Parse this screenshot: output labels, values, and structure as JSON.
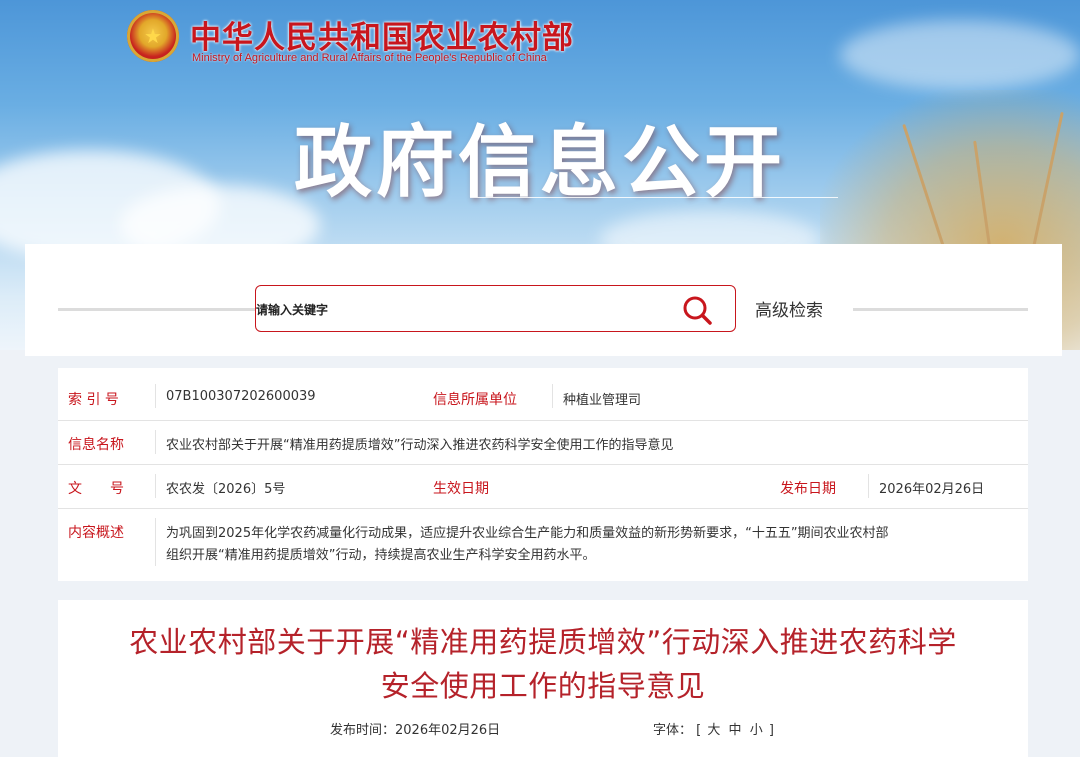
{
  "header": {
    "ministry_cn": "中华人民共和国农业农村部",
    "ministry_en": "Ministry of Agriculture and Rural Affairs of the People's Republic of China",
    "section_title": "政府信息公开",
    "emblem_icon": "national-emblem-icon"
  },
  "search": {
    "placeholder": "请输入关键字",
    "icon": "search-icon",
    "advanced_label": "高级检索"
  },
  "info": {
    "index_label": "索 引 号",
    "index_value": "07B100307202600039",
    "unit_label": "信息所属单位",
    "unit_value": "种植业管理司",
    "name_label": "信息名称",
    "name_value": "农业农村部关于开展“精准用药提质增效”行动深入推进农药科学安全使用工作的指导意见",
    "docno_label": "文　　号",
    "docno_value": "农农发〔2026〕5号",
    "effective_label": "生效日期",
    "effective_value": "",
    "publish_label": "发布日期",
    "publish_value": "2026年02月26日",
    "summary_label": "内容概述",
    "summary_line1": "为巩固到2025年化学农药减量化行动成果，适应提升农业综合生产能力和质量效益的新形势新要求，“十五五”期间农业农村部",
    "summary_line2": "组织开展“精准用药提质增效”行动，持续提高农业生产科学安全用药水平。"
  },
  "article": {
    "title_line1": "农业农村部关于开展“精准用药提质增效”行动深入推进农药科学",
    "title_line2": "安全使用工作的指导意见",
    "publish_time_label": "发布时间：",
    "publish_time_value": "2026年02月26日",
    "font_label": "字体：",
    "bracket_open": "[",
    "font_large": "大",
    "font_medium": "中",
    "font_small": "小",
    "bracket_close": "]"
  },
  "colors": {
    "accent_red": "#c8161d",
    "title_red": "#b5222a"
  }
}
